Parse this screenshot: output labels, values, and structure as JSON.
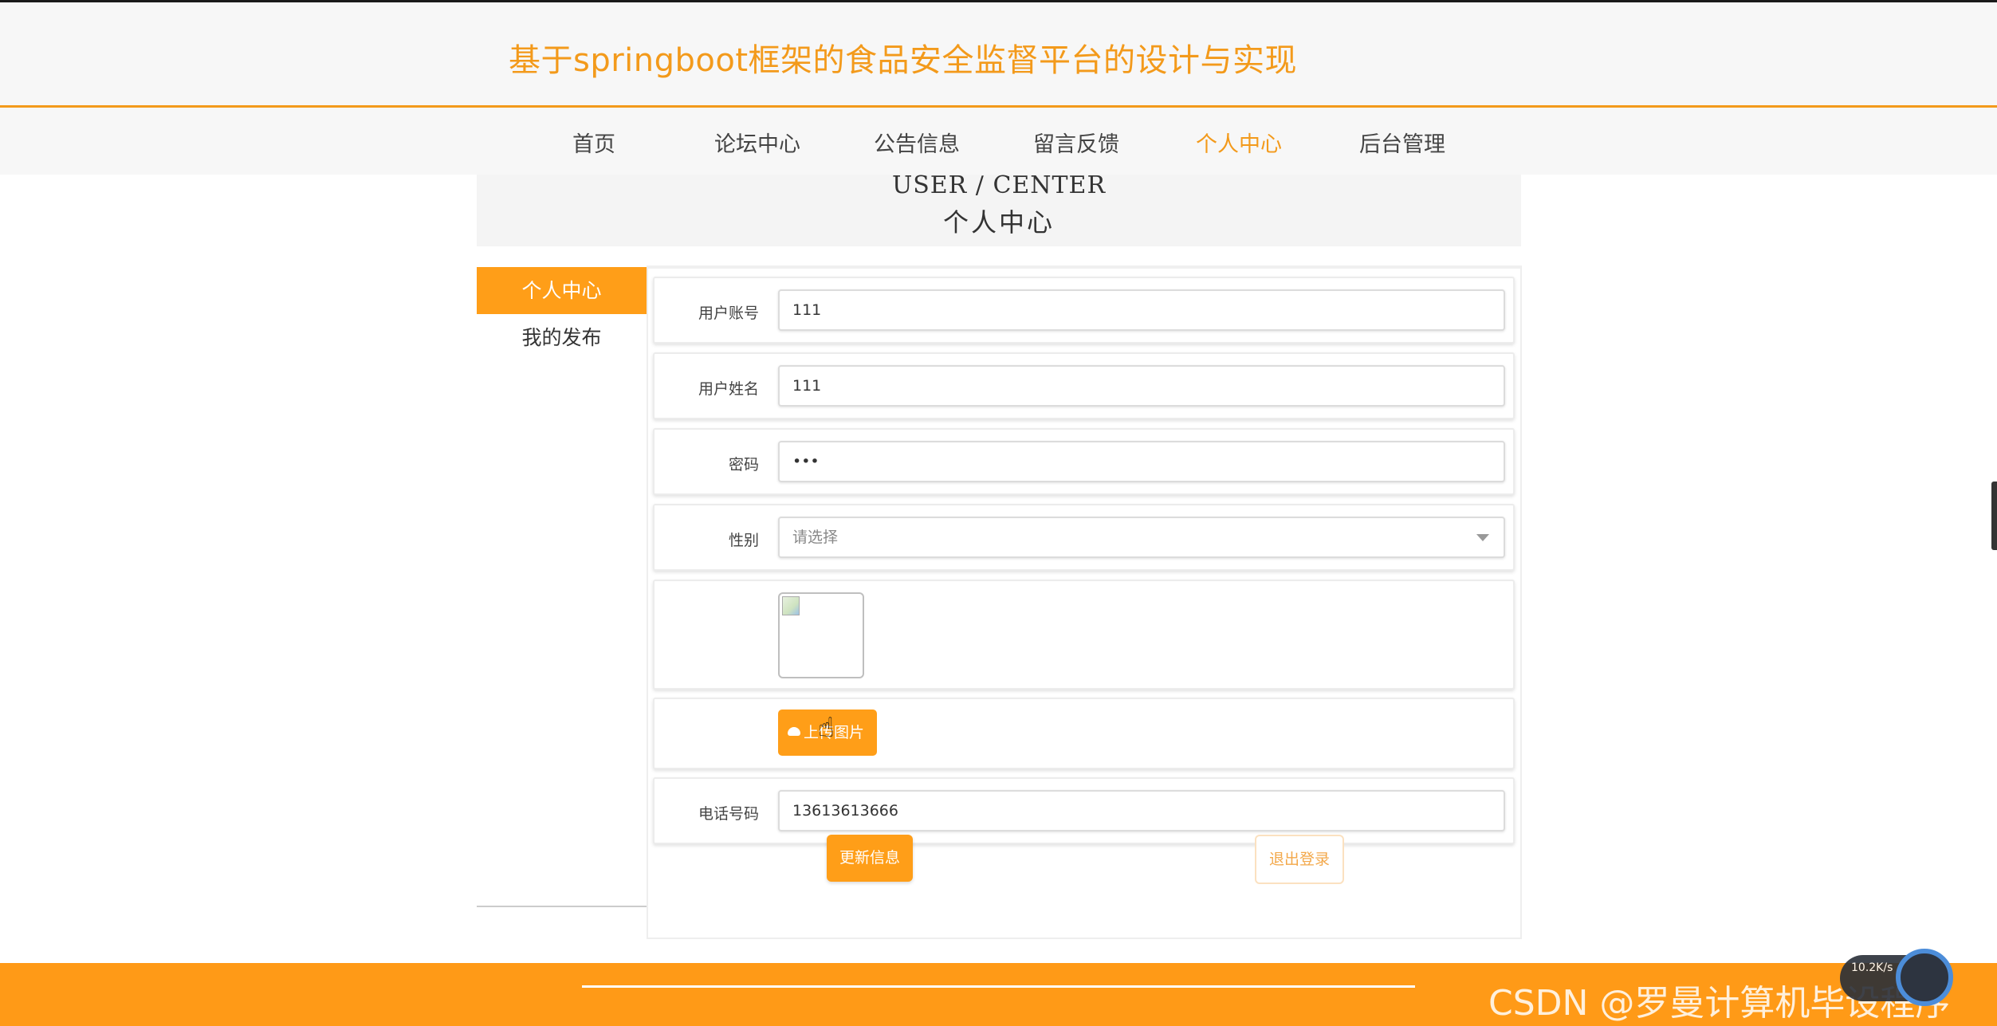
{
  "site": {
    "title": "基于springboot框架的食品安全监督平台的设计与实现"
  },
  "nav": {
    "items": [
      {
        "label": "首页"
      },
      {
        "label": "论坛中心"
      },
      {
        "label": "公告信息"
      },
      {
        "label": "留言反馈"
      },
      {
        "label": "个人中心"
      },
      {
        "label": "后台管理"
      }
    ],
    "active": "个人中心"
  },
  "banner": {
    "en": "USER / CENTER",
    "cn": "个人中心"
  },
  "sidebar": {
    "items": [
      {
        "label": "个人中心"
      },
      {
        "label": "我的发布"
      }
    ]
  },
  "form": {
    "account_label": "用户账号",
    "account_value": "111",
    "name_label": "用户姓名",
    "name_value": "111",
    "password_label": "密码",
    "password_value": "•••",
    "gender_label": "性别",
    "gender_placeholder": "请选择",
    "upload_label": "上传图片",
    "phone_label": "电话号码",
    "phone_value": "13613613666"
  },
  "actions": {
    "update": "更新信息",
    "logout": "退出登录"
  },
  "watermark": {
    "text": "CSDN @罗曼计算机毕设程序"
  },
  "speed": {
    "text": "10.2K/s"
  },
  "colors": {
    "accent": "#ff9e18",
    "title": "#f39a1b"
  },
  "icons": {
    "upload": "cloud-upload-icon",
    "caret": "chevron-down-icon",
    "cursor": "hand-pointer-icon"
  }
}
